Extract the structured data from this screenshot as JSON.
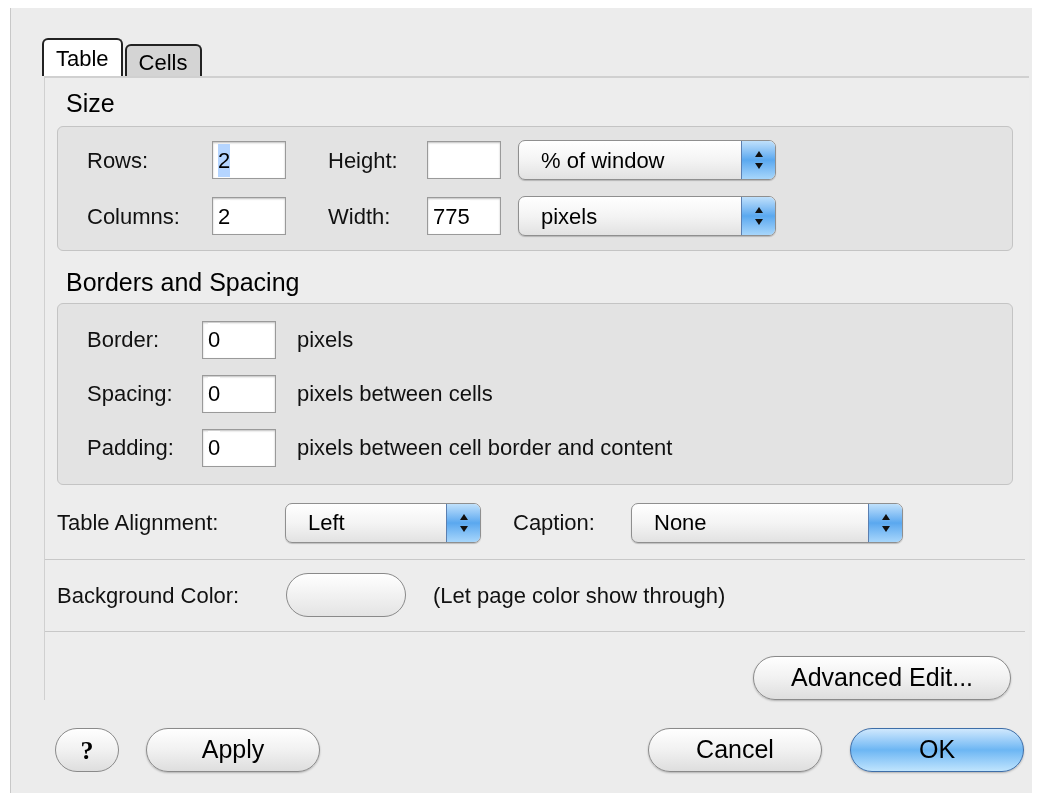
{
  "tabs": [
    {
      "label": "Table",
      "selected": true
    },
    {
      "label": "Cells",
      "selected": false
    }
  ],
  "size": {
    "title": "Size",
    "rows": [
      {
        "label": "Rows:",
        "value": "2",
        "text_selected": true,
        "dim_label": "Height:",
        "unit": "% of window"
      },
      {
        "label": "Columns:",
        "value": "2",
        "text_selected": false,
        "dim_label": "Width:",
        "dim_value": "775",
        "unit": "pixels"
      }
    ]
  },
  "borders": {
    "title": "Borders and Spacing",
    "rows": [
      {
        "label": "Border:",
        "value": "0",
        "note": "pixels"
      },
      {
        "label": "Spacing:",
        "value": "0",
        "note": "pixels between cells"
      },
      {
        "label": "Padding:",
        "value": "0",
        "note": "pixels between cell border and content"
      }
    ]
  },
  "alignment": {
    "label": "Table Alignment:",
    "value": "Left"
  },
  "caption": {
    "label": "Caption:",
    "value": "None"
  },
  "background": {
    "label": "Background Color:",
    "note": "(Let page color show through)"
  },
  "advanced_button": "Advanced Edit...",
  "help_button": "?",
  "left_buttons": [
    {
      "label": "Apply",
      "default": false
    }
  ],
  "right_buttons": [
    {
      "label": "Cancel",
      "default": false
    },
    {
      "label": "OK",
      "default": true
    }
  ]
}
